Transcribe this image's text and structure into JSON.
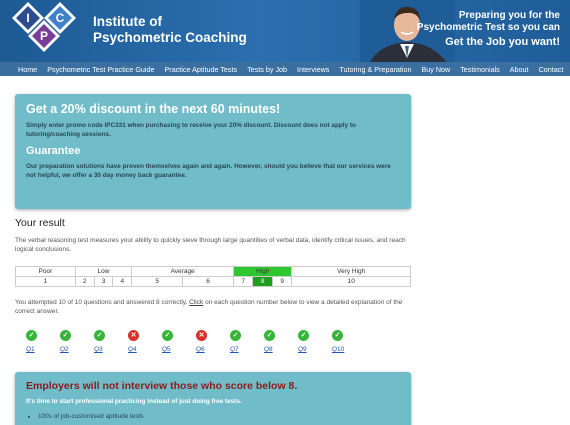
{
  "header": {
    "logo_letters": [
      "I",
      "P",
      "C"
    ],
    "brand_line1": "Institute of",
    "brand_line2": "Psychometric Coaching",
    "tagline_line1": "Preparing you for the",
    "tagline_line2": "Psychometric Test so you can",
    "tagline_line3": "Get the Job you want!"
  },
  "nav": {
    "items": [
      "Home",
      "Psychometric Test Practice Guide",
      "Practice Aptitude Tests",
      "Tests by Job",
      "Interviews",
      "Tutoring & Preparation",
      "Buy Now",
      "Testimonials",
      "About",
      "Contact"
    ]
  },
  "promo": {
    "title": "Get a 20% discount in the next 60 minutes!",
    "text": "Simply enter promo code IPC331 when purchasing to receive your 20% discount. Discount does not apply to tutoring/coaching sessions.",
    "guarantee_title": "Guarantee",
    "guarantee_text": "Our preparation solutions have proven themselves again and again. However, should you believe that our services were not helpful, we offer a 30 day money back guarantee."
  },
  "result": {
    "title": "Your result",
    "description": "The verbal reasoning test measures your ability to quickly sieve through large quantities of verbal data, identify critical issues, and reach logical conclusions.",
    "levels": [
      "Poor",
      "Low",
      "Average",
      "High",
      "Very High"
    ],
    "scores": [
      "1",
      "2",
      "3",
      "4",
      "5",
      "6",
      "7",
      "8",
      "9",
      "10"
    ],
    "attempt_prefix": "You attempted 10 of 10 questions and answered 8 correctly. ",
    "attempt_link": "Click",
    "attempt_suffix": " on each question number below to view a detailed explanation of the correct answer.",
    "questions": [
      {
        "label": "Q1",
        "correct": true
      },
      {
        "label": "Q2",
        "correct": true
      },
      {
        "label": "Q3",
        "correct": true
      },
      {
        "label": "Q4",
        "correct": false
      },
      {
        "label": "Q5",
        "correct": true
      },
      {
        "label": "Q6",
        "correct": false
      },
      {
        "label": "Q7",
        "correct": true
      },
      {
        "label": "Q8",
        "correct": true
      },
      {
        "label": "Q9",
        "correct": true
      },
      {
        "label": "Q10",
        "correct": true
      }
    ]
  },
  "employers": {
    "title": "Employers will not interview those who score below 8.",
    "text": "It's time to start professional practicing instead of just doing free tests.",
    "bullet": "100s of job-customised aptitude tests"
  },
  "colors": {
    "header_blue": "#1d5a94",
    "nav_blue": "#3a6f9f",
    "box_teal": "#70bdc9",
    "highlight_green": "#2fc72f",
    "correct_green": "#36b536",
    "wrong_red": "#d8302a"
  }
}
